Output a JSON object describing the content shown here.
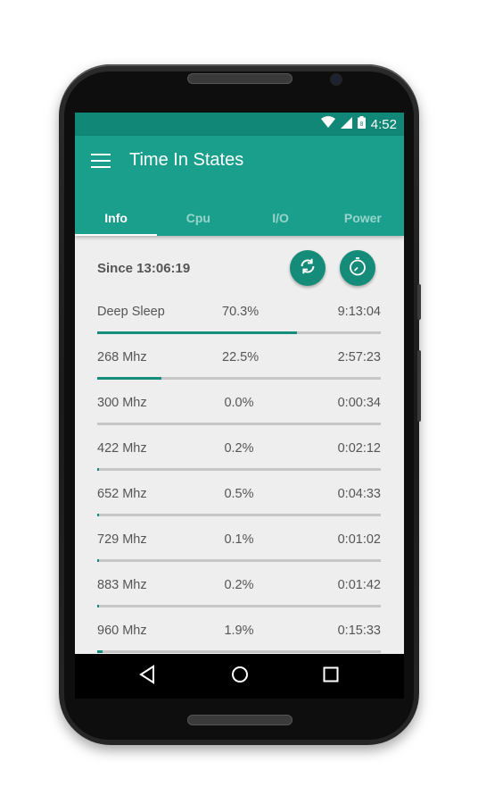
{
  "status_bar": {
    "time": "4:52"
  },
  "app": {
    "title": "Time In States"
  },
  "tabs": [
    {
      "label": "Info",
      "active": true
    },
    {
      "label": "Cpu",
      "active": false
    },
    {
      "label": "I/O",
      "active": false
    },
    {
      "label": "Power",
      "active": false
    }
  ],
  "since_label": "Since 13:06:19",
  "actions": {
    "refresh_icon": "refresh-icon",
    "timer_icon": "stopwatch-icon"
  },
  "states": [
    {
      "label": "Deep Sleep",
      "percent": "70.3%",
      "time": "9:13:04",
      "fraction": 0.703
    },
    {
      "label": "268 Mhz",
      "percent": "22.5%",
      "time": "2:57:23",
      "fraction": 0.225
    },
    {
      "label": "300 Mhz",
      "percent": "0.0%",
      "time": "0:00:34",
      "fraction": 0.0
    },
    {
      "label": "422 Mhz",
      "percent": "0.2%",
      "time": "0:02:12",
      "fraction": 0.002
    },
    {
      "label": "652 Mhz",
      "percent": "0.5%",
      "time": "0:04:33",
      "fraction": 0.005
    },
    {
      "label": "729 Mhz",
      "percent": "0.1%",
      "time": "0:01:02",
      "fraction": 0.001
    },
    {
      "label": "883 Mhz",
      "percent": "0.2%",
      "time": "0:01:42",
      "fraction": 0.002
    },
    {
      "label": "960 Mhz",
      "percent": "1.9%",
      "time": "0:15:33",
      "fraction": 0.019
    }
  ],
  "colors": {
    "primary": "#1a9f8c",
    "primary_dark": "#118877",
    "accent": "#158c79"
  }
}
